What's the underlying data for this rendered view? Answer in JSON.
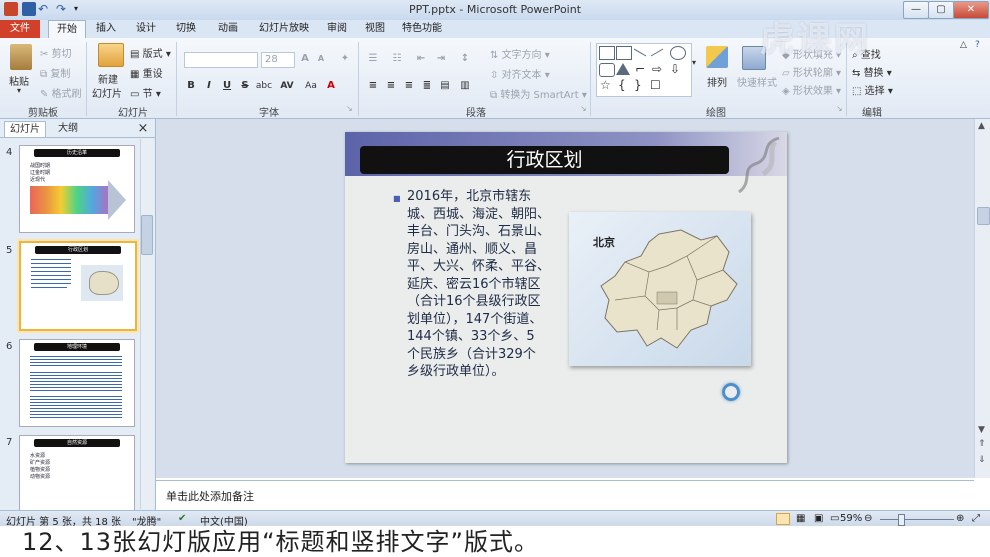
{
  "window": {
    "title": "PPT.pptx - Microsoft PowerPoint"
  },
  "tabs": [
    "文件",
    "开始",
    "插入",
    "设计",
    "切换",
    "动画",
    "幻灯片放映",
    "审阅",
    "视图",
    "特色功能"
  ],
  "ribbon": {
    "clipboard": {
      "paste": "粘贴",
      "cut": "剪切",
      "copy": "复制",
      "format_painter": "格式刷",
      "label": "剪贴板"
    },
    "slides": {
      "new_slide": "新建",
      "new_slide_2": "幻灯片",
      "layout": "版式",
      "reset": "重设",
      "section": "节",
      "label": "幻灯片"
    },
    "font": {
      "size": "28",
      "bold": "B",
      "italic": "I",
      "underline": "U",
      "strike": "S",
      "shadow": "abc",
      "spacing": "AV",
      "case": "Aa",
      "grow": "A",
      "shrink": "A",
      "label": "字体"
    },
    "paragraph": {
      "text_direction": "文字方向",
      "align_text": "对齐文本",
      "smartart": "转换为 SmartArt",
      "label": "段落"
    },
    "drawing": {
      "arrange": "排列",
      "quick_styles": "快速样式",
      "shape_fill": "形状填充",
      "shape_outline": "形状轮廓",
      "shape_effects": "形状效果",
      "label": "绘图"
    },
    "editing": {
      "find": "查找",
      "replace": "替换",
      "select": "选择",
      "label": "编辑"
    }
  },
  "panel": {
    "tab_slides": "幻灯片",
    "tab_outline": "大纲",
    "close": "×"
  },
  "thumbnails": [
    {
      "num": "4",
      "title": "历史沿革",
      "lines": [
        "战国时期",
        "辽金时期",
        "近现代"
      ]
    },
    {
      "num": "5",
      "title": "行政区划"
    },
    {
      "num": "6",
      "title": "地理环境"
    },
    {
      "num": "7",
      "title": "自然资源",
      "lines": [
        "水资源",
        "矿产资源",
        "植物资源",
        "动物资源"
      ]
    }
  ],
  "slide": {
    "title": "行政区划",
    "body_lines": [
      "2016年，北京市辖东",
      "城、西城、海淀、朝阳、",
      "丰台、门头沟、石景山、",
      "房山、通州、顺义、昌",
      "平、大兴、怀柔、平谷、",
      "延庆、密云16个市辖区",
      "（合计16个县级行政区",
      "划单位），147个街道、",
      "144个镇、33个乡、5",
      "个民族乡（合计329个",
      "乡级行政单位）。"
    ],
    "map_label": "北京"
  },
  "notes": {
    "placeholder": "单击此处添加备注"
  },
  "status": {
    "slide_info": "幻灯片 第 5 张，共 18 张",
    "theme": "\"龙腾\"",
    "language": "中文(中国)",
    "zoom": "59%"
  },
  "caption": {
    "text": "12、13张幻灯版应用“标题和竖排文字”版式。"
  },
  "watermark": {
    "text": "虎课网"
  },
  "colors": {
    "file_tab": "#d0402a",
    "ribbon_bg": "#e1e9f4",
    "slide_title_band": "#5c63a8",
    "selected_thumb": "#f0b43b"
  }
}
